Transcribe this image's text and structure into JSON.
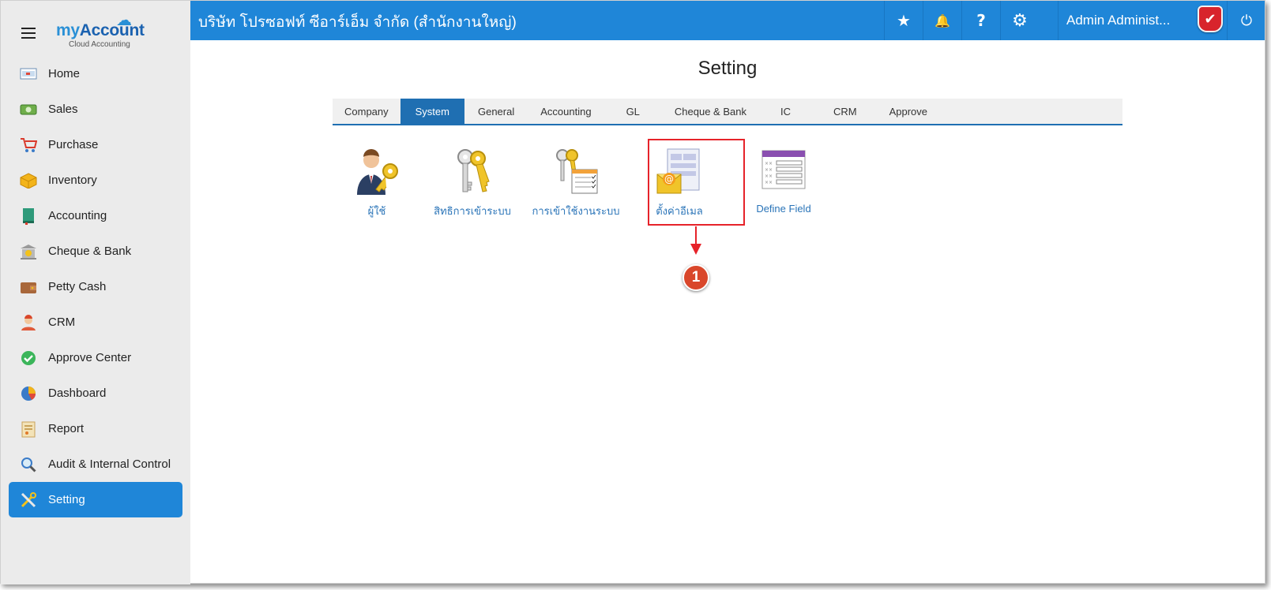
{
  "brand": {
    "name_prefix": "my",
    "name_main": "Account",
    "tagline": "Cloud Accounting"
  },
  "sidebar": {
    "items": [
      {
        "label": "Home",
        "icon": "home-icon"
      },
      {
        "label": "Sales",
        "icon": "sales-icon"
      },
      {
        "label": "Purchase",
        "icon": "cart-icon"
      },
      {
        "label": "Inventory",
        "icon": "box-icon"
      },
      {
        "label": "Accounting",
        "icon": "book-icon"
      },
      {
        "label": "Cheque & Bank",
        "icon": "bank-icon"
      },
      {
        "label": "Petty Cash",
        "icon": "wallet-icon"
      },
      {
        "label": "CRM",
        "icon": "crm-icon"
      },
      {
        "label": "Approve Center",
        "icon": "check-circle-icon"
      },
      {
        "label": "Dashboard",
        "icon": "pie-chart-icon"
      },
      {
        "label": "Report",
        "icon": "report-icon"
      },
      {
        "label": "Audit & Internal Control",
        "icon": "magnifier-icon"
      },
      {
        "label": "Setting",
        "icon": "tools-icon"
      }
    ],
    "active": "Setting"
  },
  "topbar": {
    "company": "บริษัท โปรซอฟท์ ซีอาร์เอ็ม จำกัด (สำนักงานใหญ่)",
    "user": "Admin Administ...",
    "star": "★",
    "bell": "🔔",
    "help": "?",
    "gear": "⚙",
    "power": "⏻",
    "shield_check": "✔"
  },
  "main": {
    "title": "Setting",
    "tabs": [
      "Company",
      "System",
      "General",
      "Accounting",
      "GL",
      "Cheque & Bank",
      "IC",
      "CRM",
      "Approve"
    ],
    "active_tab": "System",
    "items": [
      {
        "label": "ผู้ใช้",
        "icon": "user-key-icon"
      },
      {
        "label": "สิทธิการเข้าระบบ",
        "icon": "keys-icon"
      },
      {
        "label": "การเข้าใช้งานระบบ",
        "icon": "keys-checklist-icon"
      },
      {
        "label": "ตั้งค่าอีเมล",
        "icon": "email-settings-icon"
      },
      {
        "label": "Define Field",
        "icon": "form-fields-icon"
      }
    ],
    "callout_number": "1"
  },
  "colors": {
    "primary": "#1f86d8",
    "tab_active": "#1f6fb2",
    "highlight": "#e6232a",
    "badge": "#d9472b"
  }
}
